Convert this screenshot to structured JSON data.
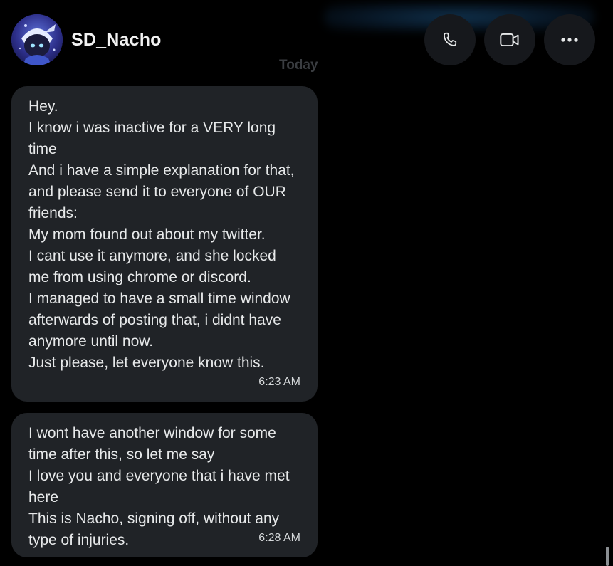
{
  "header": {
    "username": "SD_Nacho",
    "actions": [
      {
        "name": "call-button",
        "icon": "phone-icon"
      },
      {
        "name": "video-call-button",
        "icon": "video-camera-icon"
      },
      {
        "name": "more-options-button",
        "icon": "more-dots-icon"
      }
    ]
  },
  "conversation": {
    "date_divider": "Today",
    "messages": [
      {
        "text": "Hey.\nI know i was inactive for a VERY long time\nAnd i have a simple explanation for that, and please send it to everyone of OUR friends:\nMy mom found out about my twitter.\nI cant use it anymore, and she locked me from using chrome or discord.\nI managed to have a small time window afterwards of posting that, i didnt have anymore until now.\nJust please, let everyone know this.",
        "time": "6:23 AM"
      },
      {
        "text": "I wont have another window for some time after this, so let me say\nI love you and everyone that i have met here\nThis is Nacho, signing off, without any type of injuries.",
        "time": "6:28 AM"
      }
    ]
  },
  "colors": {
    "background": "#000000",
    "bubble": "#202327",
    "action_button": "#16181c",
    "text": "#e7e9ea",
    "date_divider": "#3a3d41"
  }
}
